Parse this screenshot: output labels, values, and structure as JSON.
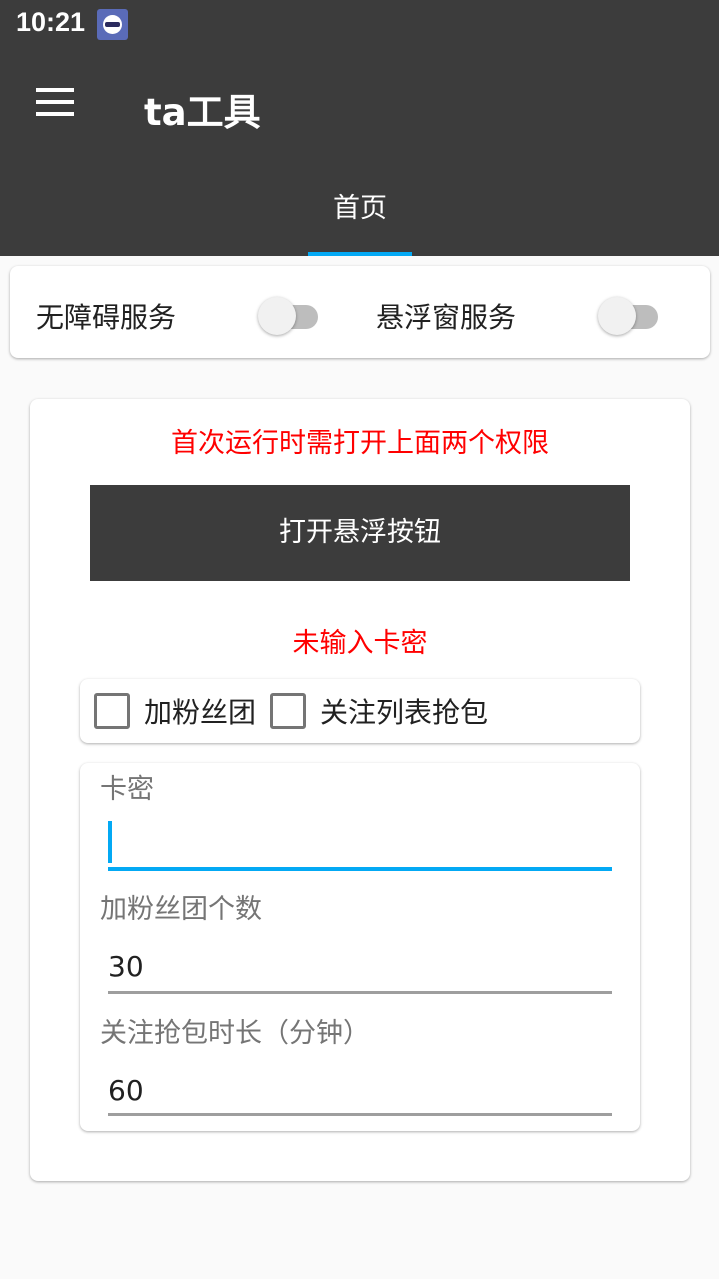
{
  "status_bar": {
    "time": "10:21",
    "app_icon": "ghost-app-icon"
  },
  "toolbar": {
    "menu_icon": "hamburger-menu-icon",
    "title": "ta工具"
  },
  "tabs": [
    {
      "label": "首页",
      "selected": true
    }
  ],
  "services": {
    "accessibility": {
      "label": "无障碍服务",
      "enabled": false
    },
    "floating_window": {
      "label": "悬浮窗服务",
      "enabled": false
    }
  },
  "main": {
    "permission_note": "首次运行时需打开上面两个权限",
    "float_button_label": "打开悬浮按钮",
    "key_status": "未输入卡密",
    "options": [
      {
        "label": "加粉丝团",
        "checked": false
      },
      {
        "label": "关注列表抢包",
        "checked": false
      }
    ],
    "form": {
      "card_key": {
        "label": "卡密",
        "value": ""
      },
      "fan_group_count": {
        "label": "加粉丝团个数",
        "value": "30"
      },
      "follow_grab_duration": {
        "label": "关注抢包时长（分钟）",
        "value": "60"
      }
    }
  },
  "colors": {
    "toolbar": "#3c3c3c",
    "accent": "#03a9f4",
    "warning_text": "#ff0000",
    "background": "#fafafa"
  }
}
